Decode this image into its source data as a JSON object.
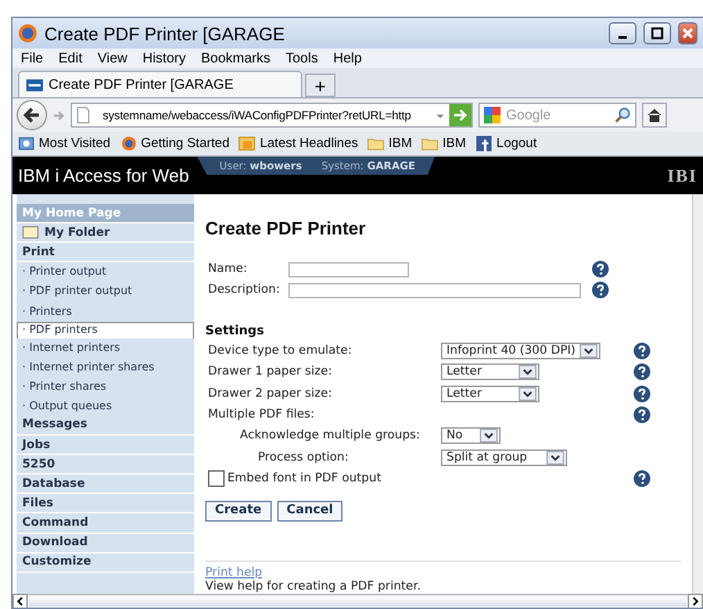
{
  "window": {
    "title": "Create PDF Printer [GARAGE"
  },
  "menu": [
    "File",
    "Edit",
    "View",
    "History",
    "Bookmarks",
    "Tools",
    "Help"
  ],
  "tabs": [
    {
      "label": "Create PDF Printer [GARAGE",
      "selected": true
    }
  ],
  "new_tab": "+",
  "address": {
    "value": "systemname/webaccess/iWAConfigPDFPrinter?retURL=http"
  },
  "search": {
    "placeholder": "Google"
  },
  "bookmarks": [
    {
      "label": "Most Visited",
      "kind": "smart"
    },
    {
      "label": "Getting Started",
      "kind": "browser"
    },
    {
      "label": "Latest Headlines",
      "kind": "feed"
    },
    {
      "label": "IBM",
      "kind": "folder"
    },
    {
      "label": "IBM",
      "kind": "folder"
    },
    {
      "label": "Logout",
      "kind": "social"
    }
  ],
  "banner": {
    "title": "IBM i Access for Web",
    "user_label": "User:",
    "user": "wbowers",
    "system_label": "System:",
    "system": "GARAGE",
    "logo": "IBI"
  },
  "sidebar": {
    "items": [
      {
        "label": "My Home Page",
        "kind": "top",
        "selected": false
      },
      {
        "label": "My Folder",
        "kind": "folder",
        "selected": false
      },
      {
        "label": "Print",
        "kind": "section",
        "selected": false
      },
      {
        "label": "· Printer output",
        "kind": "sub",
        "selected": false
      },
      {
        "label": "· PDF printer output",
        "kind": "sub",
        "selected": false
      },
      {
        "label": "· Printers",
        "kind": "sub",
        "selected": false
      },
      {
        "label": "· PDF printers",
        "kind": "sub",
        "selected": true
      },
      {
        "label": "· Internet printers",
        "kind": "sub",
        "selected": false
      },
      {
        "label": "· Internet printer shares",
        "kind": "sub",
        "selected": false
      },
      {
        "label": "· Printer shares",
        "kind": "sub",
        "selected": false
      },
      {
        "label": "· Output queues",
        "kind": "sub",
        "selected": false
      },
      {
        "label": "Messages",
        "kind": "section",
        "selected": false
      },
      {
        "label": "Jobs",
        "kind": "section",
        "selected": false
      },
      {
        "label": "5250",
        "kind": "section",
        "selected": false
      },
      {
        "label": "Database",
        "kind": "section",
        "selected": false
      },
      {
        "label": "Files",
        "kind": "section",
        "selected": false
      },
      {
        "label": "Command",
        "kind": "section",
        "selected": false
      },
      {
        "label": "Download",
        "kind": "section",
        "selected": false
      },
      {
        "label": "Customize",
        "kind": "section",
        "selected": false
      }
    ]
  },
  "form": {
    "heading": "Create PDF Printer",
    "fields": [
      {
        "label": "Name:",
        "kind": "short"
      },
      {
        "label": "Description:",
        "kind": "long"
      }
    ],
    "settings_heading": "Settings",
    "settings": [
      {
        "label": "Device type to emulate:",
        "kind": "select",
        "value": "Infoprint 40 (300 DPI)",
        "help": true
      },
      {
        "label": "Drawer 1 paper size:",
        "kind": "select",
        "value": "Letter",
        "help": true
      },
      {
        "label": "Drawer 2 paper size:",
        "kind": "select",
        "value": "Letter",
        "help": true
      },
      {
        "label": "Multiple PDF files:",
        "kind": "label",
        "help": true
      },
      {
        "label": "Acknowledge multiple groups:",
        "kind": "subselect",
        "value": "No",
        "help": false
      },
      {
        "label": "Process option:",
        "kind": "subselect2",
        "value": "Split at group",
        "help": false
      },
      {
        "label": "Embed font in PDF output",
        "kind": "checkbox",
        "checked": false,
        "help": true
      }
    ],
    "buttons": [
      "Create",
      "Cancel"
    ],
    "help_link": "Print help",
    "help_text": "View help for creating a PDF printer."
  }
}
